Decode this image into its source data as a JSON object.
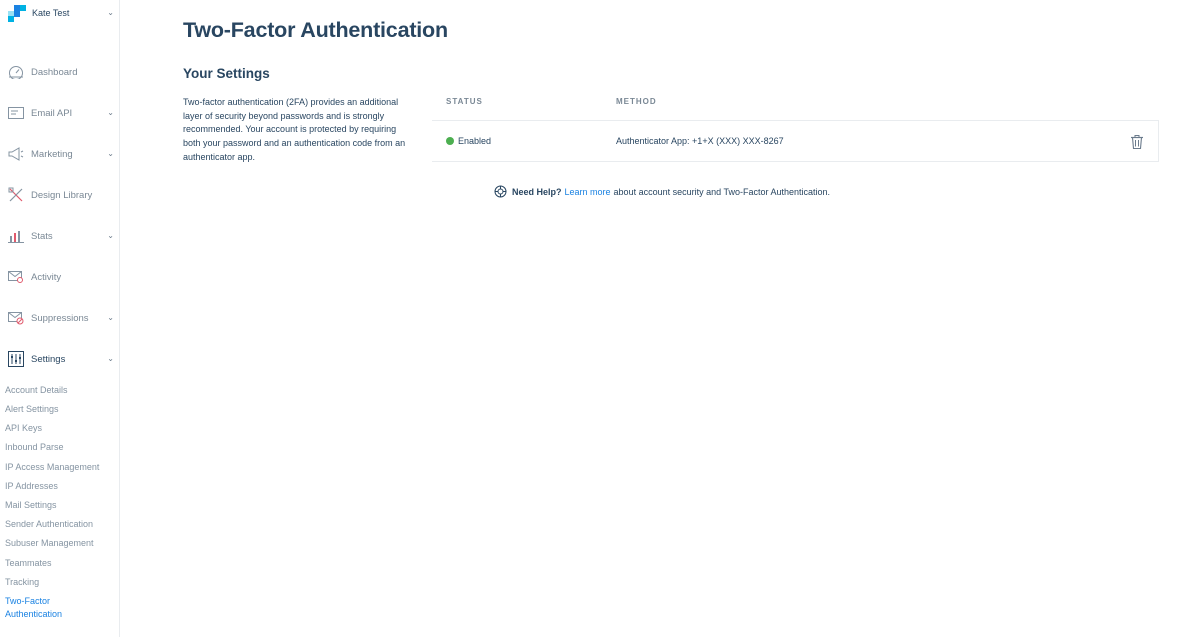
{
  "account": {
    "name": "Kate Test",
    "logo_colors": [
      "#1a82e2",
      "#00b2e3",
      "#99e1f4",
      "#294661"
    ]
  },
  "nav": [
    {
      "label": "Dashboard",
      "icon": "dashboard-icon",
      "has_chevron": false
    },
    {
      "label": "Email API",
      "icon": "email-api-icon",
      "has_chevron": true
    },
    {
      "label": "Marketing",
      "icon": "megaphone-icon",
      "has_chevron": true
    },
    {
      "label": "Design Library",
      "icon": "design-tools-icon",
      "has_chevron": false
    },
    {
      "label": "Stats",
      "icon": "bar-chart-icon",
      "has_chevron": true
    },
    {
      "label": "Activity",
      "icon": "mail-search-icon",
      "has_chevron": false
    },
    {
      "label": "Suppressions",
      "icon": "mail-block-icon",
      "has_chevron": true
    },
    {
      "label": "Settings",
      "icon": "sliders-icon",
      "has_chevron": true
    }
  ],
  "settings_sub": [
    "Account Details",
    "Alert Settings",
    "API Keys",
    "Inbound Parse",
    "IP Access Management",
    "IP Addresses",
    "Mail Settings",
    "Sender Authentication",
    "Subuser Management",
    "Teammates",
    "Tracking",
    "Two-Factor Authentication"
  ],
  "main": {
    "title": "Two-Factor Authentication",
    "section_title": "Your Settings",
    "description": "Two-factor authentication (2FA) provides an additional layer of security beyond passwords and is strongly recommended. Your account is protected by requiring both your password and an authentication code from an authenticator app."
  },
  "table": {
    "headers": {
      "status": "STATUS",
      "method": "METHOD"
    },
    "row": {
      "status": "Enabled",
      "status_color": "#4caf50",
      "method": "Authenticator App: +1+X (XXX) XXX-8267"
    }
  },
  "help": {
    "bold": "Need Help?",
    "link": "Learn more",
    "text": "about account security and Two-Factor Authentication."
  },
  "colors": {
    "accent": "#1a82e2",
    "text": "#294661",
    "muted": "#7a8895"
  }
}
